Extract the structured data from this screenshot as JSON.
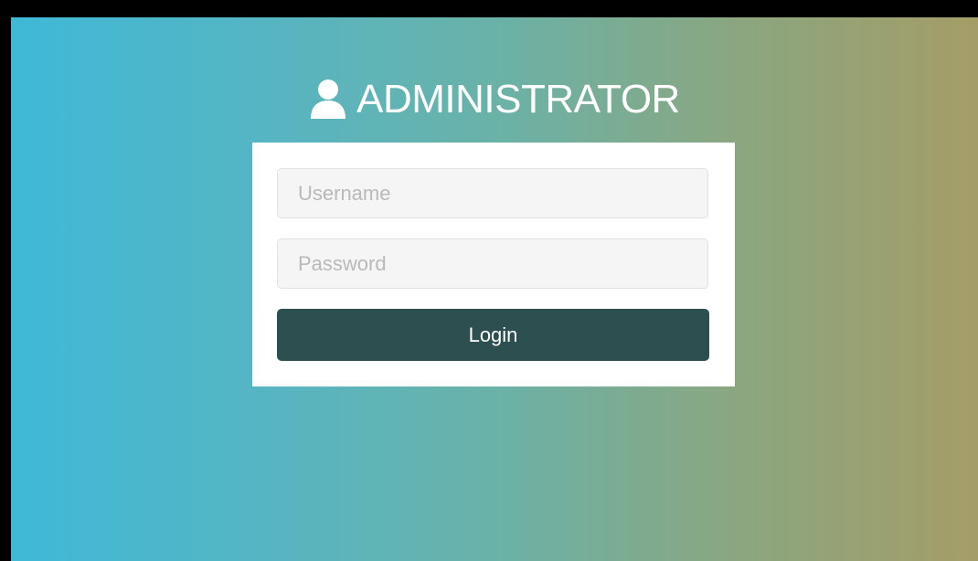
{
  "header": {
    "icon": "user-icon",
    "title": "ADMINISTRATOR"
  },
  "form": {
    "username_placeholder": "Username",
    "username_value": "",
    "password_placeholder": "Password",
    "password_value": "",
    "login_label": "Login"
  },
  "colors": {
    "gradient_left": "#3fb9d8",
    "gradient_right": "#a59d68",
    "button_bg": "#2d4f4f",
    "card_bg": "#ffffff"
  }
}
